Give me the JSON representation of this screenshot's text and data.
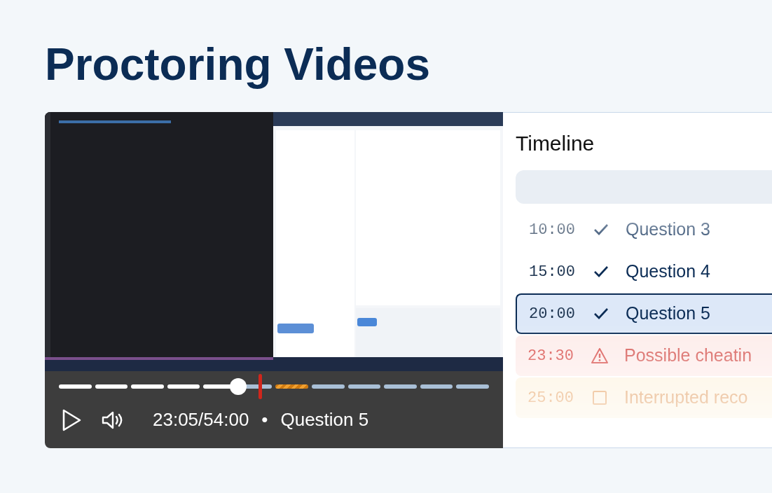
{
  "heading": "Proctoring Videos",
  "player": {
    "progress": {
      "level": 0.417,
      "marker": {
        "level": 0.467
      },
      "segments": [
        {
          "kind": "normal"
        },
        {
          "kind": "normal"
        },
        {
          "kind": "normal"
        },
        {
          "kind": "normal"
        },
        {
          "kind": "normal"
        },
        {
          "kind": "normal"
        },
        {
          "kind": "flagged"
        },
        {
          "kind": "normal"
        },
        {
          "kind": "normal"
        },
        {
          "kind": "normal"
        },
        {
          "kind": "normal"
        },
        {
          "kind": "normal"
        }
      ]
    },
    "playing": false,
    "time": "23:05/54:00",
    "separator": "•",
    "current": "Question 5"
  },
  "timeline": {
    "title": "Timeline",
    "items": [
      {
        "time": "10:00",
        "kind": "done",
        "label": "Question 3",
        "selected": false
      },
      {
        "time": "15:00",
        "kind": "done",
        "label": "Question 4",
        "selected": false
      },
      {
        "time": "20:00",
        "kind": "done",
        "label": "Question 5",
        "selected": true
      },
      {
        "time": "23:30",
        "kind": "warning",
        "label": "Possible cheatin",
        "selected": false
      },
      {
        "time": "25:00",
        "kind": "interrupted",
        "label": "Interrupted reco",
        "selected": false
      }
    ]
  }
}
